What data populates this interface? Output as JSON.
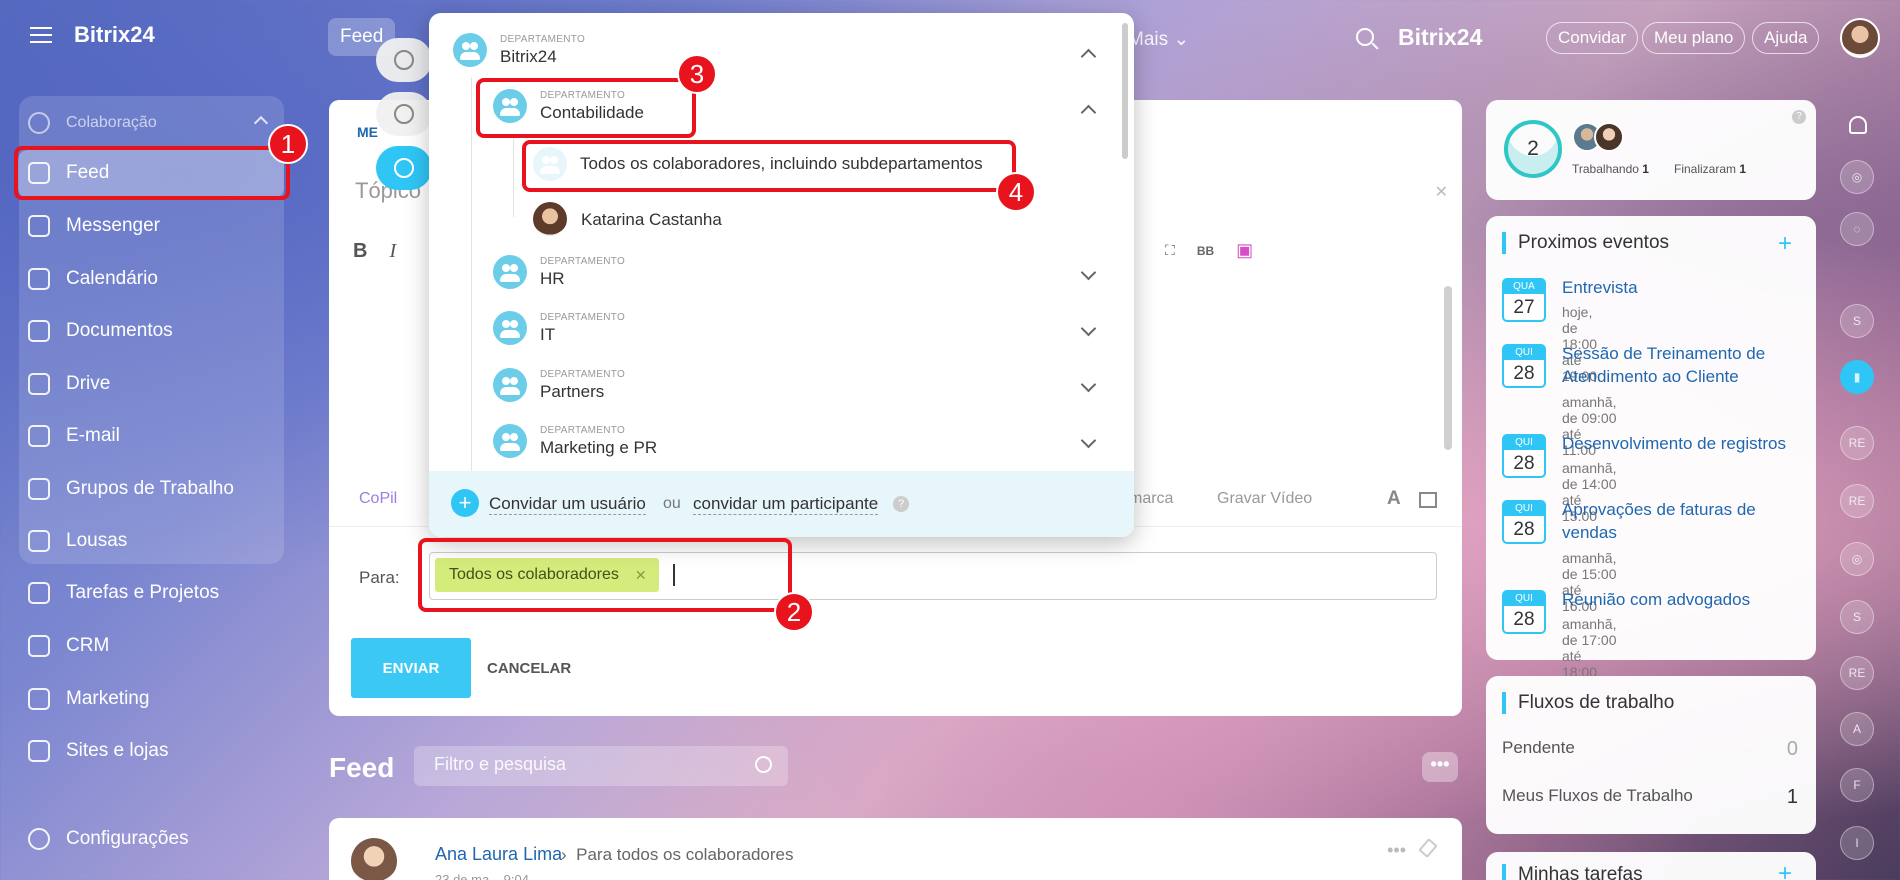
{
  "sidebar": {
    "brand": "Bitrix24",
    "group_title": "Colaboração",
    "items": [
      {
        "label": "Feed"
      },
      {
        "label": "Messenger"
      },
      {
        "label": "Calendário"
      },
      {
        "label": "Documentos"
      },
      {
        "label": "Drive"
      },
      {
        "label": "E-mail"
      },
      {
        "label": "Grupos de Trabalho"
      },
      {
        "label": "Lousas"
      },
      {
        "label": "Tarefas e Projetos"
      },
      {
        "label": "CRM"
      },
      {
        "label": "Marketing"
      },
      {
        "label": "Sites e lojas"
      }
    ],
    "settings": "Configurações"
  },
  "topbar": {
    "feed_tab": "Feed",
    "more": "Mais ⌄",
    "brand": "Bitrix24",
    "invite": "Convidar",
    "plan": "Meu plano",
    "help": "Ajuda"
  },
  "composer": {
    "tab": "ME",
    "topic_placeholder": "Tópico",
    "copilot": "CoPil",
    "marca": "marca",
    "gravar": "Gravar Vídeo",
    "to_label": "Para:",
    "chip": "Todos os colaboradores",
    "send": "ENVIAR",
    "cancel": "CANCELAR"
  },
  "popup": {
    "dept_label": "DEPARTAMENTO",
    "departments": [
      {
        "name": "Bitrix24"
      },
      {
        "name": "Contabilidade"
      },
      {
        "name": "HR"
      },
      {
        "name": "IT"
      },
      {
        "name": "Partners"
      },
      {
        "name": "Marketing e PR"
      }
    ],
    "all_sub": "Todos os colaboradores, incluindo subdepartamentos",
    "member": "Katarina Castanha",
    "invite_user": "Convidar um usuário",
    "or": "ou",
    "invite_participant": "convidar um participante"
  },
  "feed": {
    "heading": "Feed",
    "filter_placeholder": "Filtro e pesquisa",
    "post_author": "Ana Laura Lima",
    "post_target": "Para todos os colaboradores",
    "post_date": "23 de ma... 9:04"
  },
  "status": {
    "count": "2",
    "working_label": "Trabalhando",
    "working_count": "1",
    "finished_label": "Finalizaram",
    "finished_count": "1"
  },
  "events": {
    "title": "Proximos eventos",
    "items": [
      {
        "day": "QUA",
        "num": "27",
        "title": "Entrevista",
        "time": "hoje, de 18:00 até 19:00"
      },
      {
        "day": "QUI",
        "num": "28",
        "title": "Sessão de Treinamento de Atendimento ao Cliente",
        "time": "amanhã, de 09:00 até 11:00"
      },
      {
        "day": "QUI",
        "num": "28",
        "title": "Desenvolvimento de registros",
        "time": "amanhã, de 14:00 até 15:00"
      },
      {
        "day": "QUI",
        "num": "28",
        "title": "Aprovações de faturas de vendas",
        "time": "amanhã, de 15:00 até 16:00"
      },
      {
        "day": "QUI",
        "num": "28",
        "title": "Reunião com advogados",
        "time": "amanhã, de 17:00 até 18:00"
      }
    ]
  },
  "workflows": {
    "title": "Fluxos de trabalho",
    "pending_label": "Pendente",
    "pending_count": "0",
    "mine_label": "Meus Fluxos de Trabalho",
    "mine_count": "1"
  },
  "tasks": {
    "title": "Minhas tarefas"
  },
  "rail": [
    "S",
    "RE",
    "RE",
    "S",
    "RE",
    "A",
    "F",
    "I"
  ],
  "annotations": [
    "1",
    "2",
    "3",
    "4"
  ],
  "colors": {
    "accent": "#2fc6f6",
    "annotation": "#e8131c",
    "chip": "#d4ec7b"
  }
}
